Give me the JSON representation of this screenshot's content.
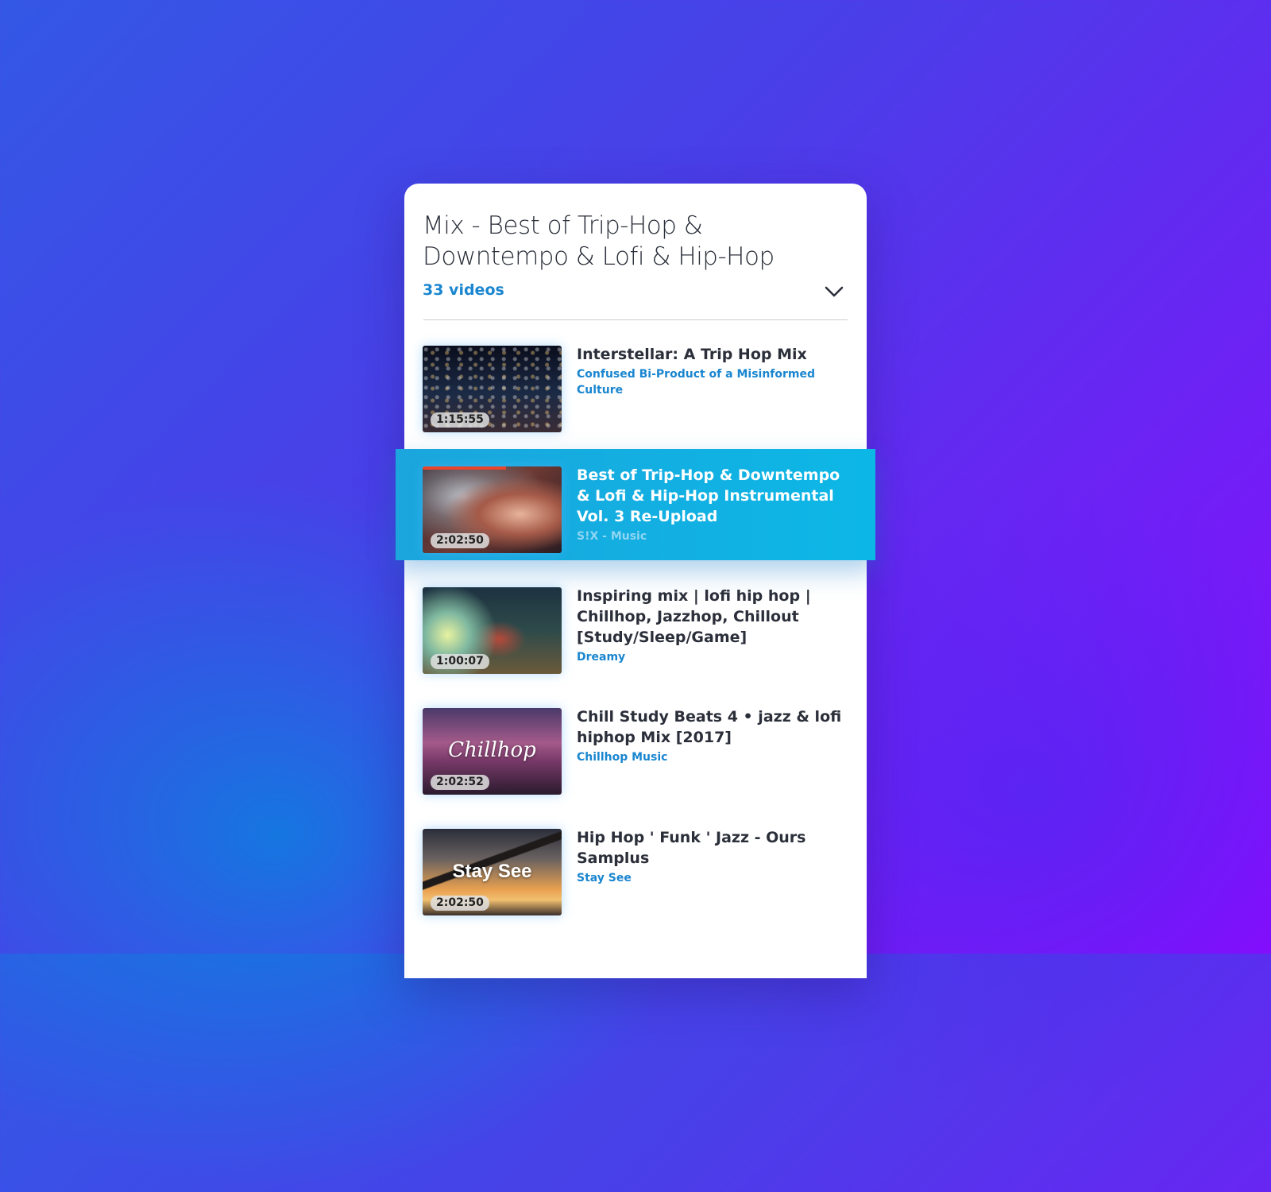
{
  "playlist": {
    "title": "Mix - Best of Trip-Hop & Downtempo & Lofi & Hip-Hop",
    "count": "33 videos",
    "toggle_icon": "chevron-down-icon"
  },
  "colors": {
    "accent": "#1a86d0",
    "active_row": "#12ace3",
    "progress": "#e8452c"
  },
  "videos": [
    {
      "title": "Interstellar: A Trip Hop Mix",
      "channel": "Confused Bi-Product of a Misinformed Culture",
      "duration": "1:15:55",
      "active": false
    },
    {
      "title": "Best of Trip-Hop & Downtempo & Lofi & Hip-Hop Instrumental Vol. 3 Re-Upload",
      "channel": "S!X - Music",
      "duration": "2:02:50",
      "active": true
    },
    {
      "title": "Inspiring mix | lofi hip hop | Chillhop, Jazzhop, Chillout [Study/Sleep/Game]",
      "channel": "Dreamy",
      "duration": "1:00:07",
      "active": false
    },
    {
      "title": "Chill Study Beats 4 • jazz & lofi hiphop Mix [2017]",
      "channel": "Chillhop Music",
      "duration": "2:02:52",
      "active": false,
      "thumb_text": "Chillhop"
    },
    {
      "title": "Hip Hop ' Funk ' Jazz - Ours Samplus",
      "channel": "Stay See",
      "duration": "2:02:50",
      "active": false,
      "thumb_text": "Stay See"
    }
  ]
}
